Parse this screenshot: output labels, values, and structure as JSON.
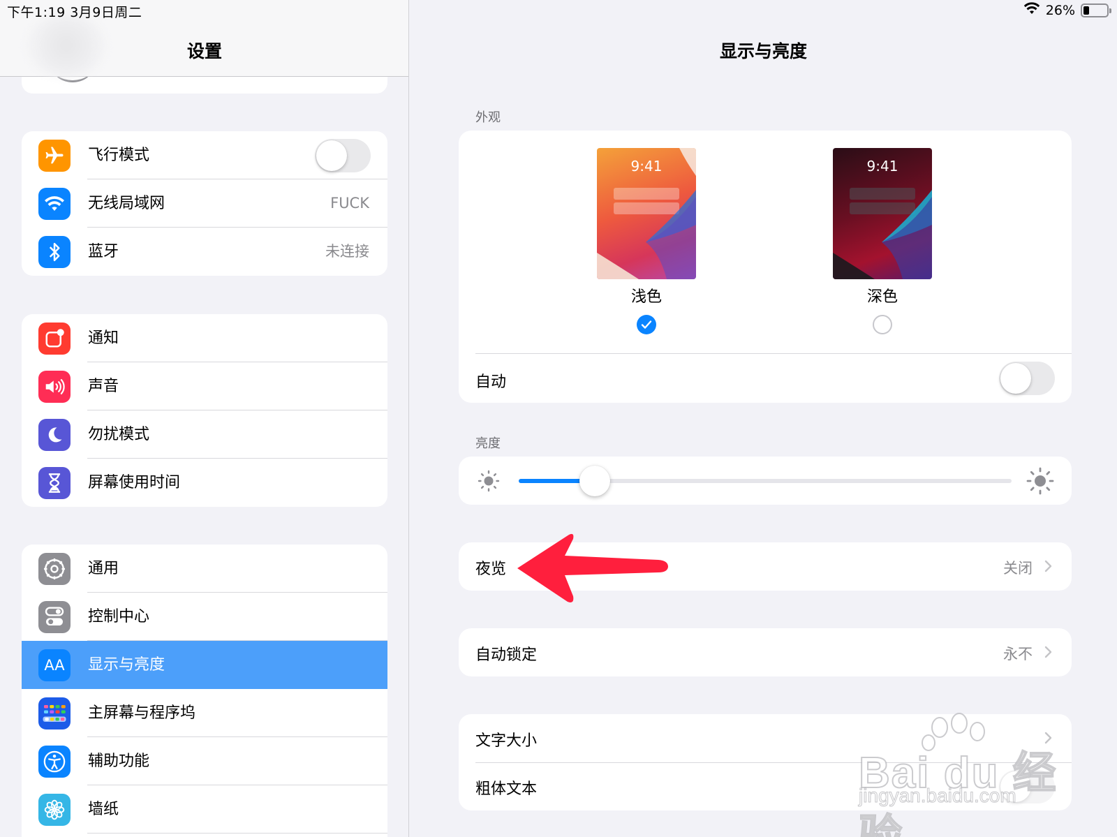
{
  "status_bar": {
    "time": "下午1:19   3月9日周二",
    "battery": "26%",
    "battery_level": 0.26
  },
  "sidebar": {
    "title": "设置",
    "group1": [
      {
        "label": "飞行模式",
        "icon": "airplane-icon",
        "color": "#ff9500",
        "toggle": false
      },
      {
        "label": "无线局域网",
        "icon": "wifi-icon",
        "color": "#0a84ff",
        "value": "FUCK"
      },
      {
        "label": "蓝牙",
        "icon": "bluetooth-icon",
        "color": "#0a84ff",
        "value": "未连接"
      }
    ],
    "group2": [
      {
        "label": "通知",
        "icon": "notifications-icon",
        "color": "#ff3b30"
      },
      {
        "label": "声音",
        "icon": "speaker-icon",
        "color": "#ff2d55"
      },
      {
        "label": "勿扰模式",
        "icon": "moon-icon",
        "color": "#5856d6"
      },
      {
        "label": "屏幕使用时间",
        "icon": "hourglass-icon",
        "color": "#5856d6"
      }
    ],
    "group3": [
      {
        "label": "通用",
        "icon": "gear-icon",
        "color": "#8e8e93"
      },
      {
        "label": "控制中心",
        "icon": "control-center-icon",
        "color": "#8e8e93"
      },
      {
        "label": "显示与亮度",
        "icon": "display-brightness-icon",
        "icon_text": "AA",
        "color": "#0a84ff",
        "selected": true
      },
      {
        "label": "主屏幕与程序坞",
        "icon": "home-screen-icon",
        "color": "#1c5ce8"
      },
      {
        "label": "辅助功能",
        "icon": "accessibility-icon",
        "color": "#0a84ff"
      },
      {
        "label": "墙纸",
        "icon": "wallpaper-icon",
        "color": "#35b6e6"
      }
    ]
  },
  "main": {
    "title": "显示与亮度",
    "appearance": {
      "header": "外观",
      "light": {
        "clock": "9:41",
        "label": "浅色",
        "selected": true
      },
      "dark": {
        "clock": "9:41",
        "label": "深色",
        "selected": false
      },
      "auto_label": "自动",
      "auto_toggle": false
    },
    "brightness": {
      "header": "亮度",
      "level": 0.155
    },
    "night_shift": {
      "label": "夜览",
      "value": "关闭"
    },
    "auto_lock": {
      "label": "自动锁定",
      "value": "永不"
    },
    "text_size": {
      "label": "文字大小"
    },
    "bold_text": {
      "label": "粗体文本"
    }
  },
  "annotation": {
    "arrow_color": "#ff1f3d"
  },
  "watermark": {
    "brand": "Bai du 经验",
    "url": "jingyan.baidu.com"
  }
}
